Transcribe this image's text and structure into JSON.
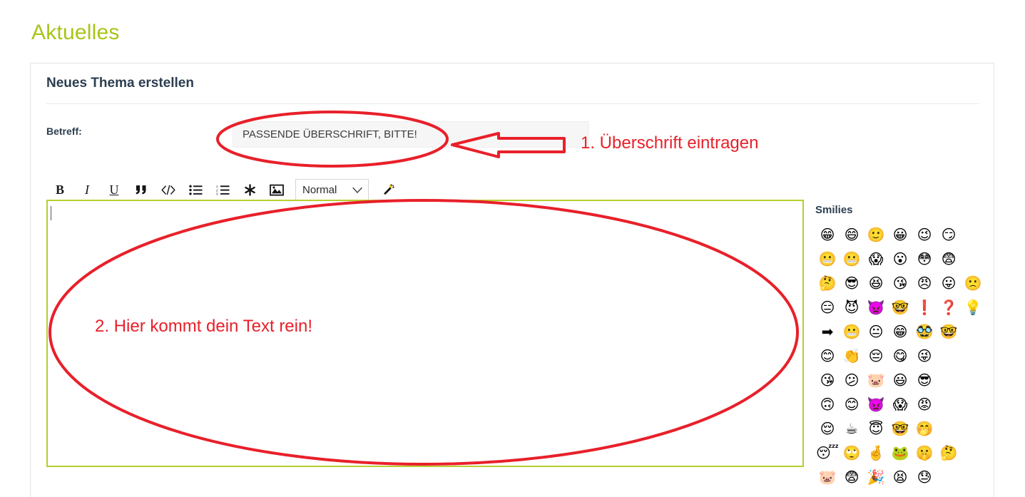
{
  "page": {
    "title": "Aktuelles"
  },
  "card": {
    "header": "Neues Thema erstellen"
  },
  "form": {
    "subject_label": "Betreff:",
    "subject_value": "",
    "subject_placeholder": "PASSENDE ÜBERSCHRIFT, BITTE!"
  },
  "toolbar": {
    "bold_label": "B",
    "italic_label": "I",
    "underline_label": "U",
    "quote_label": "❝",
    "code_label": "</>",
    "bullet_list_label": "☰",
    "numbered_list_label": "☰",
    "asterisk_label": "✱",
    "image_label": "ὛC",
    "format_select_value": "Normal",
    "format_options": [
      "Normal"
    ],
    "wand_label": "wand"
  },
  "annotations": {
    "step1": "1. Überschrift eintragen",
    "step2": "2. Hier kommt dein Text rein!",
    "accent_color": "#e8202a"
  },
  "smilies": {
    "title": "Smilies",
    "rows": [
      [
        "😁",
        "😄",
        "🙂",
        "😀",
        "😉",
        "😏"
      ],
      [
        "😬",
        "😬",
        "😱",
        "😮",
        "😳",
        "😨"
      ],
      [
        "🤔",
        "😎",
        "😆",
        "😘",
        "😠",
        "😛",
        "🙁"
      ],
      [
        "😑",
        "😈",
        "👿",
        "🤓",
        "❗",
        "❓",
        "💡"
      ],
      [
        "➡",
        "😬",
        "😐",
        "😁",
        "🥸",
        "🤓"
      ],
      [
        "😊",
        "👏",
        "😔",
        "😋",
        "😜"
      ],
      [
        "😘",
        "😕",
        "🐷",
        "😃",
        "😎"
      ],
      [
        "🙃",
        "😊",
        "👿",
        "😱",
        "😡"
      ],
      [
        "😌",
        "☕",
        "😇",
        "🤓",
        "🤭"
      ],
      [
        "😴",
        "🙄",
        "🤞",
        "🐸",
        "🤫",
        "🤔"
      ],
      [
        "🐷",
        "😨",
        "🎉",
        "😫",
        "😓"
      ]
    ]
  }
}
